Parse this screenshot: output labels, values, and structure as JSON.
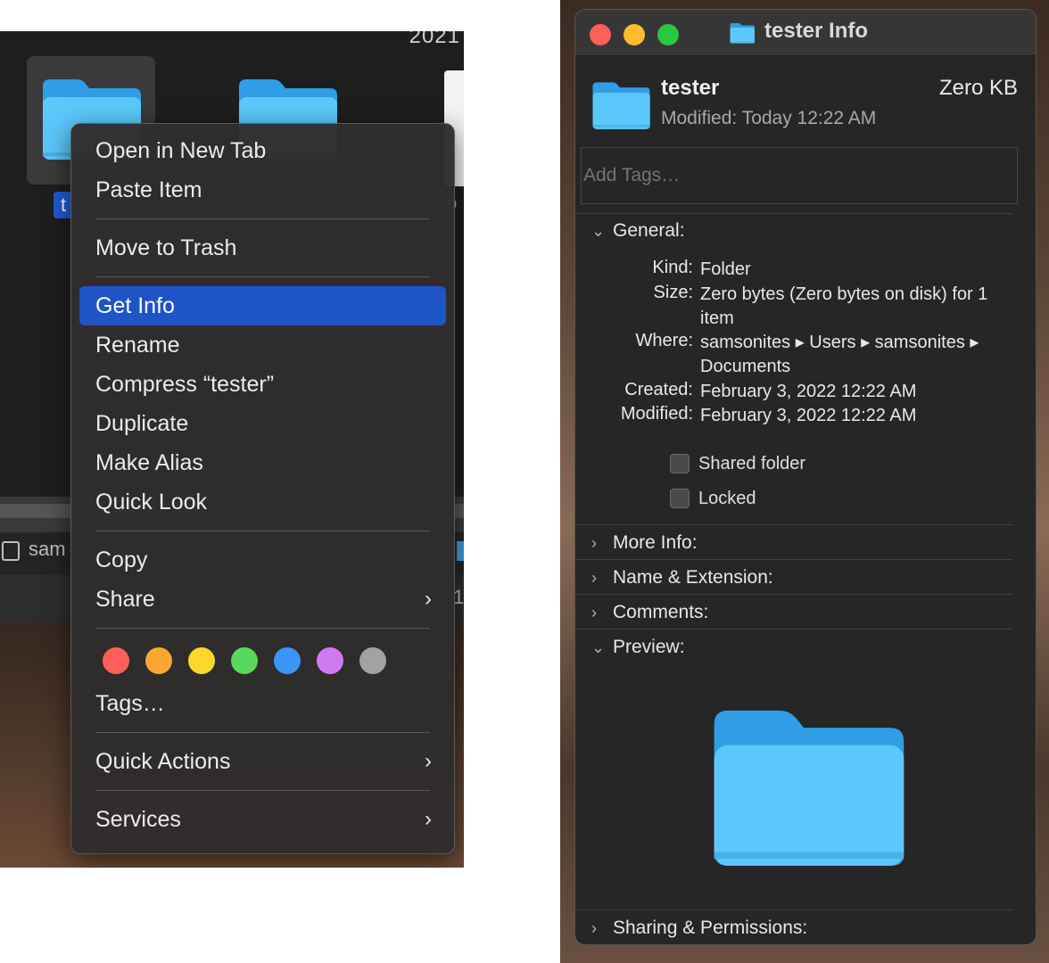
{
  "finder": {
    "year_fragment": "2021",
    "selected_label_fragment": "t",
    "doc_label_fragment": "o",
    "path_fragment": "sam",
    "status_fragment": "1"
  },
  "context_menu": {
    "group1": [
      "Open in New Tab",
      "Paste Item"
    ],
    "group2": [
      "Move to Trash"
    ],
    "group3": [
      "Get Info",
      "Rename",
      "Compress “tester”",
      "Duplicate",
      "Make Alias",
      "Quick Look"
    ],
    "copy": "Copy",
    "share": "Share",
    "tags": "Tags…",
    "quick_actions": "Quick Actions",
    "services": "Services",
    "highlighted": "Get Info",
    "tag_colors": [
      "#fe5f57",
      "#fca632",
      "#fcd82c",
      "#58d95b",
      "#3a96f8",
      "#d07af0",
      "#a2a2a4"
    ]
  },
  "info_window": {
    "title": "tester Info",
    "name": "tester",
    "size_short": "Zero KB",
    "modified_label": "Modified:",
    "modified_value": "Today 12:22 AM",
    "tags_placeholder": "Add Tags…",
    "general": {
      "header": "General:",
      "kind_label": "Kind:",
      "kind": "Folder",
      "size_label": "Size:",
      "size": "Zero bytes (Zero bytes on disk) for 1 item",
      "where_label": "Where:",
      "where": "samsonites ▸ Users ▸ samsonites ▸ Documents",
      "created_label": "Created:",
      "created": "February 3, 2022 12:22 AM",
      "modified_label": "Modified:",
      "modified": "February 3, 2022 12:22 AM",
      "shared_folder": "Shared folder",
      "locked": "Locked"
    },
    "sections": {
      "more_info": "More Info:",
      "name_ext": "Name & Extension:",
      "comments": "Comments:",
      "preview": "Preview:",
      "sharing": "Sharing & Permissions:"
    }
  },
  "icons": {
    "folder": "folder-icon",
    "chevron_right": "chevron-right-icon",
    "chevron_down": "chevron-down-icon",
    "disk": "disk-icon"
  },
  "colors": {
    "highlight": "#1e54c6",
    "folder_light": "#5bc8fb",
    "folder_dark": "#2f9ee6"
  }
}
